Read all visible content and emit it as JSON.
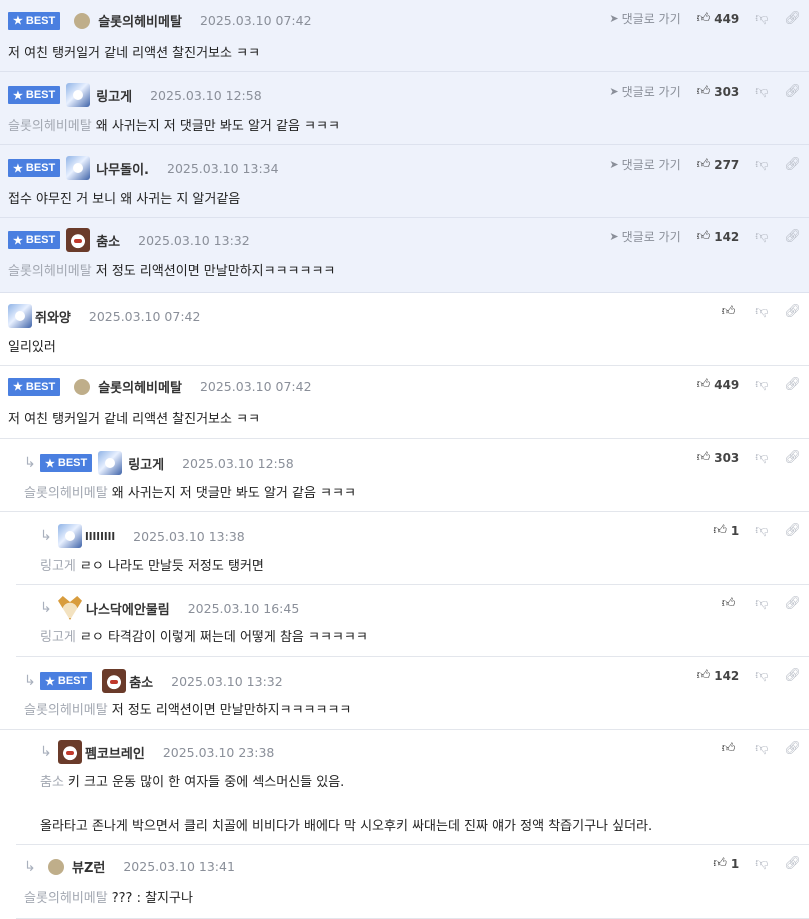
{
  "labels": {
    "best": "BEST",
    "goto_reply": "댓글로 가기"
  },
  "comments": [
    {
      "best": true,
      "author": "슬롯의헤비메탈",
      "date": "2025.03.10 07:42",
      "likes": "449",
      "quote": "",
      "text": "저 여친 탱커일거 같네 리액션 찰진거보소 ㅋㅋ"
    },
    {
      "best": true,
      "author": "링고게",
      "date": "2025.03.10 12:58",
      "likes": "303",
      "quote": "슬롯의헤비메탈",
      "text": "왜 사귀는지 저 댓글만 봐도 알거 같음 ㅋㅋㅋ"
    },
    {
      "best": true,
      "author": "나무돌이.",
      "date": "2025.03.10 13:34",
      "likes": "277",
      "quote": "",
      "text": "접수 야무진 거 보니 왜 사귀는 지 알거같음"
    },
    {
      "best": true,
      "author": "춤소",
      "date": "2025.03.10 13:32",
      "likes": "142",
      "quote": "슬롯의헤비메탈",
      "text": "저 정도 리액션이면 만날만하지ㅋㅋㅋㅋㅋㅋ"
    },
    {
      "best": false,
      "author": "쥐와양",
      "date": "2025.03.10 07:42",
      "likes": "",
      "quote": "",
      "text": "일리있러"
    },
    {
      "best": true,
      "author": "슬롯의헤비메탈",
      "date": "2025.03.10 07:42",
      "likes": "449",
      "quote": "",
      "text": "저 여친 탱커일거 같네 리액션 찰진거보소 ㅋㅋ"
    },
    {
      "best": true,
      "author": "링고게",
      "date": "2025.03.10 12:58",
      "likes": "303",
      "quote": "슬롯의헤비메탈",
      "text": "왜 사귀는지 저 댓글만 봐도 알거 같음 ㅋㅋㅋ"
    },
    {
      "best": false,
      "author": "llllllll",
      "date": "2025.03.10 13:38",
      "likes": "1",
      "quote": "링고게",
      "text": "ㄹㅇ 나라도 만날듯 저정도 탱커면"
    },
    {
      "best": false,
      "author": "나스닥에안물림",
      "date": "2025.03.10 16:45",
      "likes": "",
      "quote": "링고게",
      "text": "ㄹㅇ 타격감이 이렇게 쩌는데 어떻게 참음 ㅋㅋㅋㅋㅋ"
    },
    {
      "best": true,
      "author": "춤소",
      "date": "2025.03.10 13:32",
      "likes": "142",
      "quote": "슬롯의헤비메탈",
      "text": "저 정도 리액션이면 만날만하지ㅋㅋㅋㅋㅋㅋ"
    },
    {
      "best": false,
      "author": "펨코브레인",
      "date": "2025.03.10 23:38",
      "likes": "",
      "quote": "춤소",
      "text": "키 크고 운동 많이 한 여자들 중에 섹스머신들 있음.",
      "text2": "올라타고 존나게 박으면서 클리 치골에 비비다가 배에다 막 시오후키 싸대는데 진짜 얘가 정액 착즙기구나 싶더라."
    },
    {
      "best": false,
      "author": "뷰Z런",
      "date": "2025.03.10 13:41",
      "likes": "1",
      "quote": "슬롯의헤비메탈",
      "text": "??? : 찰지구나"
    }
  ],
  "icons": {
    "best_star": "star-icon",
    "goto_arrow": "send-arrow-icon",
    "like": "thumbs-up-icon",
    "dislike": "thumbs-down-icon",
    "link": "link-icon",
    "reply": "reply-arrow-icon"
  },
  "colors": {
    "best_badge": "#4a7fe0",
    "best_bg": "#eef2fb",
    "quote": "#a3a8b2",
    "date": "#8a8f99"
  }
}
